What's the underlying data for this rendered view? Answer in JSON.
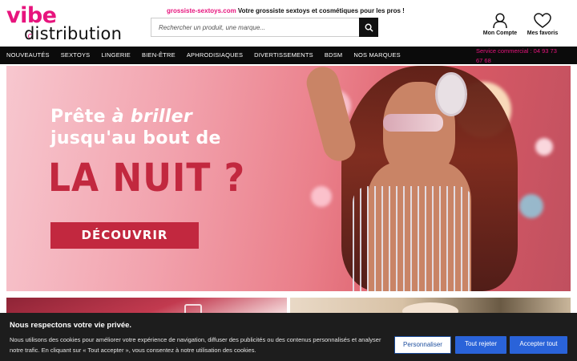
{
  "brand": {
    "logo_line1": "vibe",
    "logo_line2": "distribution",
    "accent": "#e7147d"
  },
  "tagline": {
    "site": "grossiste-sextoys.com",
    "text": " Votre grossiste sextoys et cosmétiques pour les pros !"
  },
  "search": {
    "placeholder": "Rechercher un produit, une marque...",
    "button_icon": "search-icon"
  },
  "account": {
    "label": "Mon Compte",
    "icon": "user-icon"
  },
  "favorites": {
    "label": "Mes favoris",
    "icon": "heart-icon"
  },
  "nav": {
    "items": [
      "NOUVEAUTÉS",
      "SEXTOYS",
      "LINGERIE",
      "BIEN-ÊTRE",
      "APHRODISIAQUES",
      "DIVERTISSEMENTS",
      "BDSM",
      "NOS MARQUES"
    ]
  },
  "service": {
    "text": "Service commercial : 04 93 73 67 68"
  },
  "hero": {
    "line1_a": "Prête ",
    "line1_b": "à briller",
    "line2": "jusqu'au bout de",
    "big": "LA NUIT ?",
    "cta": "DÉCOUVRIR",
    "accent": "#c2283f"
  },
  "cookie": {
    "title": "Nous respectons votre vie privée.",
    "text": "Nous utilisons des cookies pour améliorer votre expérience de navigation, diffuser des publicités ou des contenus personnalisés et analyser notre trafic. En cliquant sur « Tout accepter », vous consentez à notre utilisation des cookies.",
    "customize": "Personnaliser",
    "reject": "Tout rejeter",
    "accept": "Accepter tout",
    "button_color": "#2a63d9"
  }
}
